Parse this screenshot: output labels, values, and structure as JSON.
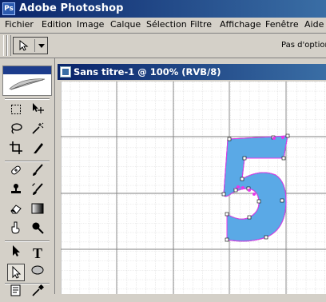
{
  "app": {
    "title": "Adobe Photoshop",
    "logo_text": "Ps"
  },
  "menu": [
    {
      "label": "Fichier"
    },
    {
      "label": "Edition"
    },
    {
      "label": "Image"
    },
    {
      "label": "Calque"
    },
    {
      "label": "Sélection"
    },
    {
      "label": "Filtre"
    },
    {
      "label": "Affichage"
    },
    {
      "label": "Fenêtre"
    },
    {
      "label": "Aide"
    }
  ],
  "options_bar": {
    "active_tool_icon": "direct-selection-icon",
    "no_options_text": "Pas d'option"
  },
  "toolbox": {
    "tools": [
      {
        "name": "marquee-tool-icon",
        "glyph": "⬚"
      },
      {
        "name": "move-tool-icon",
        "glyph": "✥"
      },
      {
        "name": "lasso-tool-icon",
        "glyph": "ꝏ"
      },
      {
        "name": "magic-wand-tool-icon",
        "glyph": "✳"
      },
      {
        "name": "crop-tool-icon",
        "glyph": "⌗"
      },
      {
        "name": "slice-tool-icon",
        "glyph": "⁄"
      },
      {
        "name": "healing-brush-tool-icon",
        "glyph": "✚"
      },
      {
        "name": "brush-tool-icon",
        "glyph": "✎"
      },
      {
        "name": "stamp-tool-icon",
        "glyph": "♟"
      },
      {
        "name": "history-brush-tool-icon",
        "glyph": "ℬ"
      },
      {
        "name": "eraser-tool-icon",
        "glyph": "▭"
      },
      {
        "name": "gradient-tool-icon",
        "glyph": "▦"
      },
      {
        "name": "smudge-tool-icon",
        "glyph": "☝"
      },
      {
        "name": "dodge-tool-icon",
        "glyph": "●"
      },
      {
        "name": "path-selection-tool-icon",
        "glyph": "➤"
      },
      {
        "name": "type-tool-icon",
        "glyph": "T"
      },
      {
        "name": "direct-selection-tool-icon",
        "glyph": "↖"
      },
      {
        "name": "ellipse-tool-icon",
        "glyph": "⬭"
      },
      {
        "name": "notes-tool-icon",
        "glyph": "▤"
      },
      {
        "name": "eyedropper-tool-icon",
        "glyph": "⁄"
      },
      {
        "name": "hand-tool-icon",
        "glyph": "✋"
      },
      {
        "name": "zoom-tool-icon",
        "glyph": "⌕"
      }
    ]
  },
  "document": {
    "title": "Sans titre-1 @ 100% (RVB/8)"
  },
  "canvas": {
    "glyph": "5",
    "shape_fill": "#5aa9e6",
    "path_color": "#ff40ff"
  },
  "colors": {
    "titlebar": "#0a246a",
    "chrome": "#d4d0c8"
  }
}
